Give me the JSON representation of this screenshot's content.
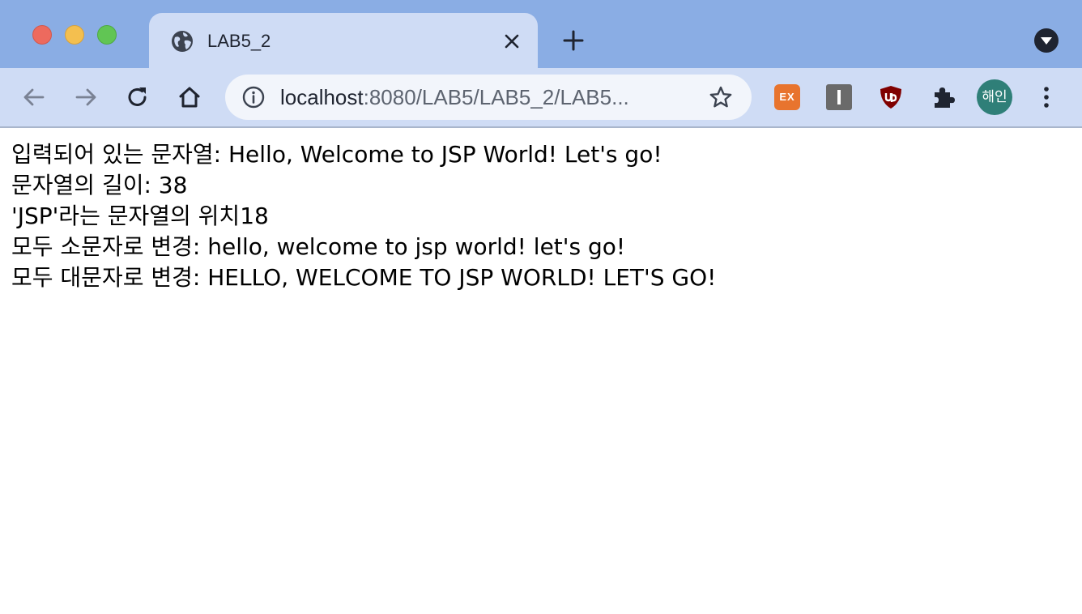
{
  "window": {
    "traffic_lights": [
      "close",
      "minimize",
      "zoom"
    ]
  },
  "tab": {
    "title": "LAB5_2",
    "icon": "globe-icon"
  },
  "toolbar": {
    "back_icon": "arrow-left-icon",
    "forward_icon": "arrow-right-icon",
    "reload_icon": "reload-icon",
    "home_icon": "home-icon",
    "address": {
      "host": "localhost",
      "rest": ":8080/LAB5/LAB5_2/LAB5..."
    },
    "extensions": {
      "ex_label": "EX"
    },
    "profile_label": "해인"
  },
  "content": {
    "lines": [
      "입력되어 있는 문자열: Hello, Welcome to JSP World! Let's go!",
      "문자열의 길이: 38",
      "'JSP'라는 문자열의 위치18",
      "모두 소문자로 변경: hello, welcome to jsp world! let's go!",
      "모두 대문자로 변경: HELLO, WELCOME TO JSP WORLD! LET'S GO!"
    ]
  },
  "colors": {
    "tabstrip": "#8aade4",
    "active_tab": "#cfdcf5",
    "omnibox": "#f2f5fb",
    "avatar": "#2f7f78",
    "ext_orange": "#e8742e",
    "ublock_red": "#800000"
  }
}
